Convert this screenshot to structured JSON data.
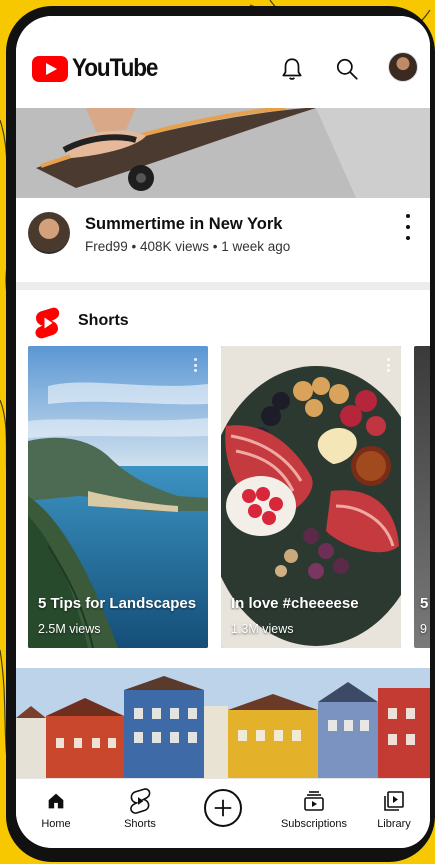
{
  "app": {
    "logo_text": "YouTube",
    "brand_color": "#FF0000",
    "header_icons": [
      "bell-icon",
      "search-icon",
      "account-avatar"
    ]
  },
  "featured_video": {
    "title": "Summertime in New York",
    "subtitle": "Fred99 • 408K views • 1 week ago"
  },
  "shorts": {
    "section_title": "Shorts",
    "items": [
      {
        "title": "5 Tips for Landscapes",
        "views": "2.5M views"
      },
      {
        "title": "In love #cheeeese",
        "views": "1.3M views"
      },
      {
        "title": "5",
        "views": "9"
      }
    ]
  },
  "bottom_nav": {
    "items": [
      {
        "label": "Home",
        "icon": "home-icon",
        "active": true
      },
      {
        "label": "Shorts",
        "icon": "shorts-icon"
      },
      {
        "label": "",
        "icon": "create-plus-icon"
      },
      {
        "label": "Subscriptions",
        "icon": "subscriptions-icon"
      },
      {
        "label": "Library",
        "icon": "library-icon"
      }
    ]
  }
}
